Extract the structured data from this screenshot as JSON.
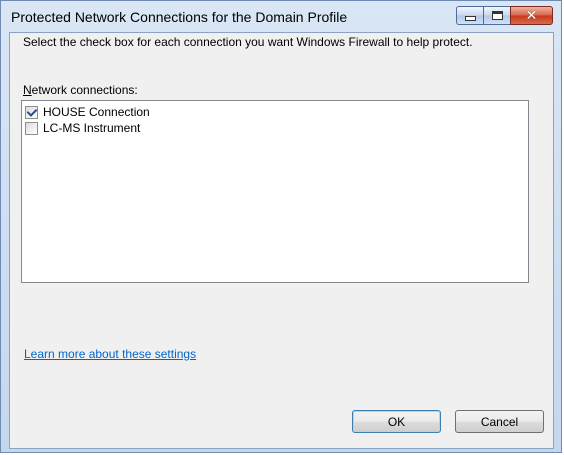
{
  "window": {
    "title": "Protected Network Connections for the Domain Profile"
  },
  "dialog": {
    "instruction": "Select the check box for each connection you want Windows Firewall to help protect.",
    "list_label_prefix": "",
    "list_label_accel": "N",
    "list_label_rest": "etwork connections:",
    "connections": [
      {
        "label": "HOUSE Connection",
        "checked": true
      },
      {
        "label": "LC-MS Instrument",
        "checked": false
      }
    ],
    "learn_more_link": "Learn more about these settings",
    "ok_label": "OK",
    "cancel_label": "Cancel"
  },
  "colors": {
    "link": "#0066cc",
    "close_button": "#c7381b",
    "title_bar": "#d9e6f5"
  }
}
